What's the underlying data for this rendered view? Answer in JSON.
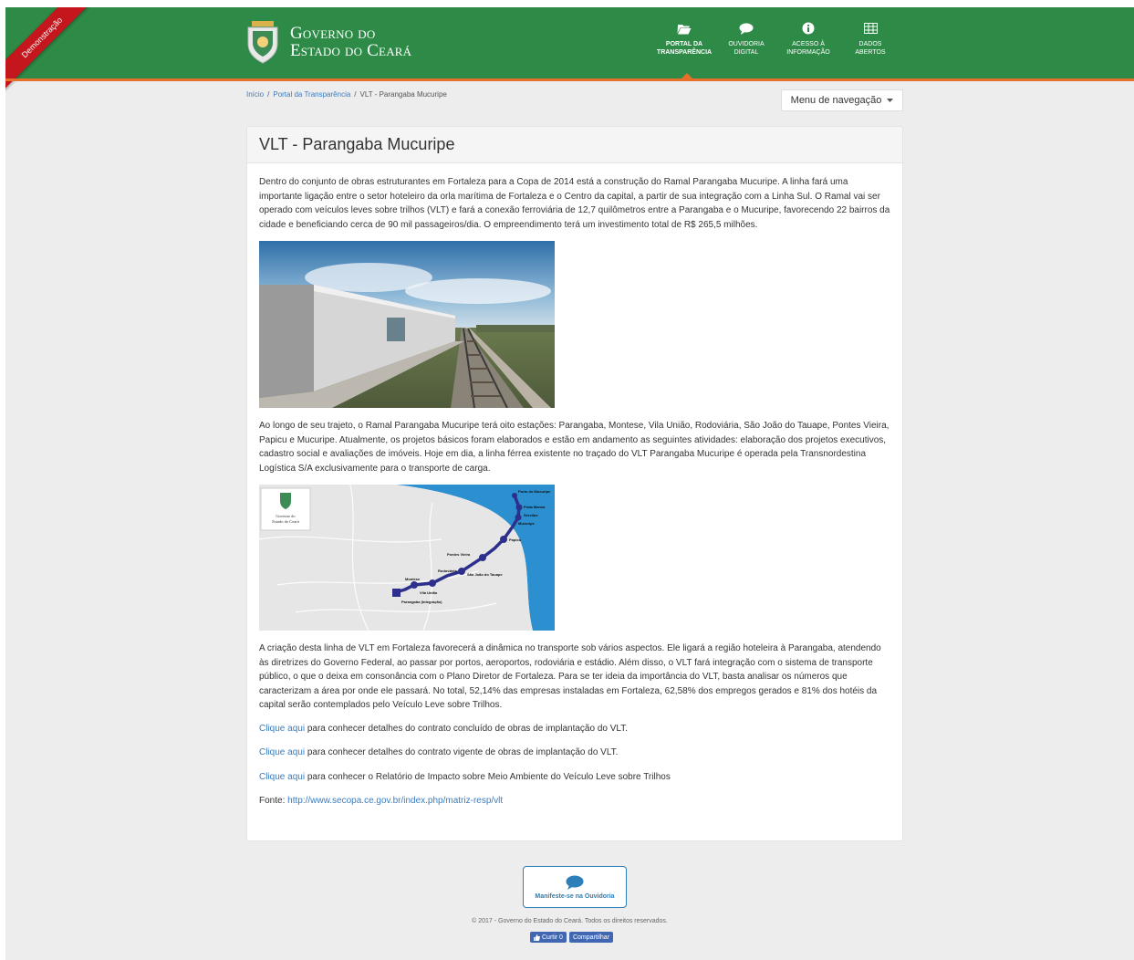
{
  "ribbon": {
    "label": "Demonstração"
  },
  "header": {
    "logo_line1": "Governo do",
    "logo_line2": "Estado do Ceará",
    "nav": [
      {
        "line1": "Portal da",
        "line2": "Transparência",
        "icon": "folder-open-icon"
      },
      {
        "line1": "Ouvidoria",
        "line2": "Digital",
        "icon": "speech-bubble-icon"
      },
      {
        "line1": "Acesso à",
        "line2": "Informação",
        "icon": "info-icon"
      },
      {
        "line1": "Dados",
        "line2": "Abertos",
        "icon": "table-icon"
      }
    ]
  },
  "breadcrumb": {
    "items": [
      "Início",
      "Portal da Transparência",
      "VLT - Parangaba Mucuripe"
    ],
    "sep": "/"
  },
  "menu_button": {
    "label": "Menu de navegação"
  },
  "page": {
    "title": "VLT - Parangaba Mucuripe",
    "para1": "Dentro do conjunto de obras estruturantes em Fortaleza para a Copa de 2014 está a construção do Ramal Parangaba Mucuripe. A linha fará uma importante ligação entre o setor hoteleiro da orla marítima de Fortaleza e o Centro da capital, a partir de sua integração com a Linha Sul. O Ramal vai ser operado com veículos leves sobre trilhos (VLT) e fará a conexão ferroviária de 12,7 quilômetros entre a Parangaba e o Mucuripe, favorecendo 22 bairros da cidade e beneficiando cerca de 90 mil passageiros/dia. O empreendimento terá um investimento total de R$ 265,5 milhões.",
    "para2": "Ao longo de seu trajeto, o Ramal Parangaba Mucuripe terá oito estações: Parangaba, Montese, Vila União, Rodoviária, São João do Tauape, Pontes Vieira, Papicu e Mucuripe. Atualmente, os projetos básicos foram elaborados e estão em andamento as seguintes atividades: elaboração dos projetos executivos, cadastro social e avaliações de imóveis. Hoje em dia, a linha férrea existente no traçado do VLT Parangaba Mucuripe é operada pela Transnordestina Logística S/A exclusivamente para o transporte de carga.",
    "para3": "A criação desta linha de VLT em Fortaleza favorecerá a dinâmica no transporte sob vários aspectos. Ele ligará a região hoteleira à Parangaba, atendendo às diretrizes do Governo Federal, ao passar por portos, aeroportos, rodoviária e estádio. Além disso, o VLT fará integração com o sistema de transporte público, o que o deixa em consonância com o Plano Diretor de Fortaleza. Para se ter ideia da importância do VLT, basta analisar os números que caracterizam a área por onde ele passará. No total, 52,14% das empresas instaladas em Fortaleza, 62,58% dos empregos gerados e 81% dos hotéis da capital serão contemplados pelo Veículo Leve sobre Trilhos.",
    "links": [
      {
        "link": "Clique aqui",
        "rest": " para conhecer detalhes do contrato concluído de obras de implantação do VLT."
      },
      {
        "link": "Clique aqui",
        "rest": " para conhecer detalhes do contrato vigente de obras de implantação do VLT."
      },
      {
        "link": "Clique aqui",
        "rest": " para conhecer o Relatório de Impacto sobre Meio Ambiente do Veículo Leve sobre Trilhos"
      }
    ],
    "source_label": "Fonte: ",
    "source_url": "http://www.secopa.ce.gov.br/index.php/matriz-resp/vlt"
  },
  "map": {
    "logo_line1": "Governo do",
    "logo_line2": "Estado do Ceará",
    "stations": [
      "Porto do Mucuripe",
      "Praia Mansa",
      "Servilus",
      "Mucuripe",
      "Papicu",
      "Pontes Vieira",
      "São João do Tauape",
      "Rodoviária",
      "Montese",
      "Vila União",
      "Parangaba (Integração)"
    ]
  },
  "footer": {
    "ouvidoria_label": "Manifeste-se na Ouvidoria",
    "copyright": "© 2017 - Governo do Estado do Ceará. Todos os direitos reservados.",
    "like_label": "Curtir 0",
    "share_label": "Compartilhar"
  },
  "colors": {
    "green": "#2e8a47",
    "orange": "#e86e2b",
    "link": "#3a7dc0"
  }
}
